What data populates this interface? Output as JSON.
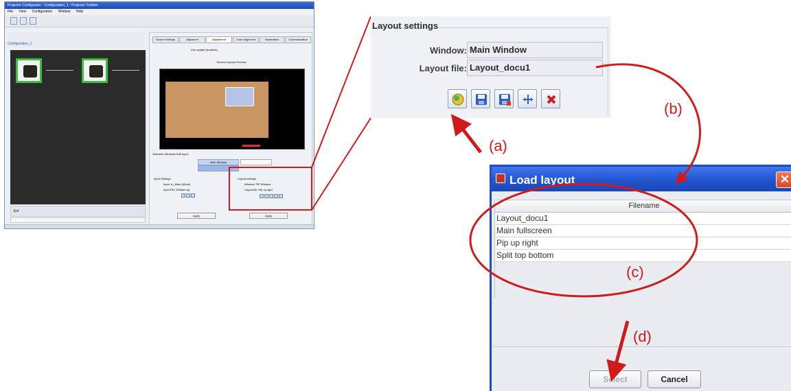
{
  "app": {
    "title": "Projector Configurator - Configuration_1 - Projector Toolbox",
    "menu": [
      "File",
      "View",
      "Configuration",
      "Window",
      "Help"
    ],
    "config_tab": "Configuration_1",
    "status_label": "Ext",
    "right_tabs": [
      "Source Settings",
      "Alignment",
      "Adjustment",
      "Color Alignment",
      "Illumination",
      "Communication"
    ],
    "display_control": "Live update (enabled)",
    "preview_label": "Screen Layouts Preview",
    "selection_tabs": "Selection  Windows  Edit  Input",
    "main_window_label": "Main Window",
    "input_settings_title": "Input Settings",
    "input_settings_rows": [
      "Input:  In_Main (Mode)",
      "Input File:  Default.cfg"
    ],
    "small_layout_title": "Layout settings",
    "small_layout_rows": [
      "Window:  PIP Window",
      "Layout file:  Pip up right"
    ],
    "apply_label": "Apply"
  },
  "layout_settings": {
    "title": "Layout settings",
    "window_label": "Window:",
    "window_value": "Main Window",
    "layout_file_label": "Layout file:",
    "layout_file_value": "Layout_docu1",
    "buttons": [
      "load-layout-icon",
      "save-icon",
      "save-as-icon",
      "align-icon",
      "delete-icon"
    ]
  },
  "dialog": {
    "title": "Load layout",
    "column_header": "Filename",
    "rows": [
      "Layout_docu1",
      "Main fullscreen",
      "Pip up right",
      "Split top bottom"
    ],
    "select_label": "Select",
    "cancel_label": "Cancel",
    "close_symbol": "✕"
  },
  "annotations": {
    "a": "(a)",
    "b": "(b)",
    "c": "(c)",
    "d": "(d)",
    "color": "#d11a1a"
  }
}
